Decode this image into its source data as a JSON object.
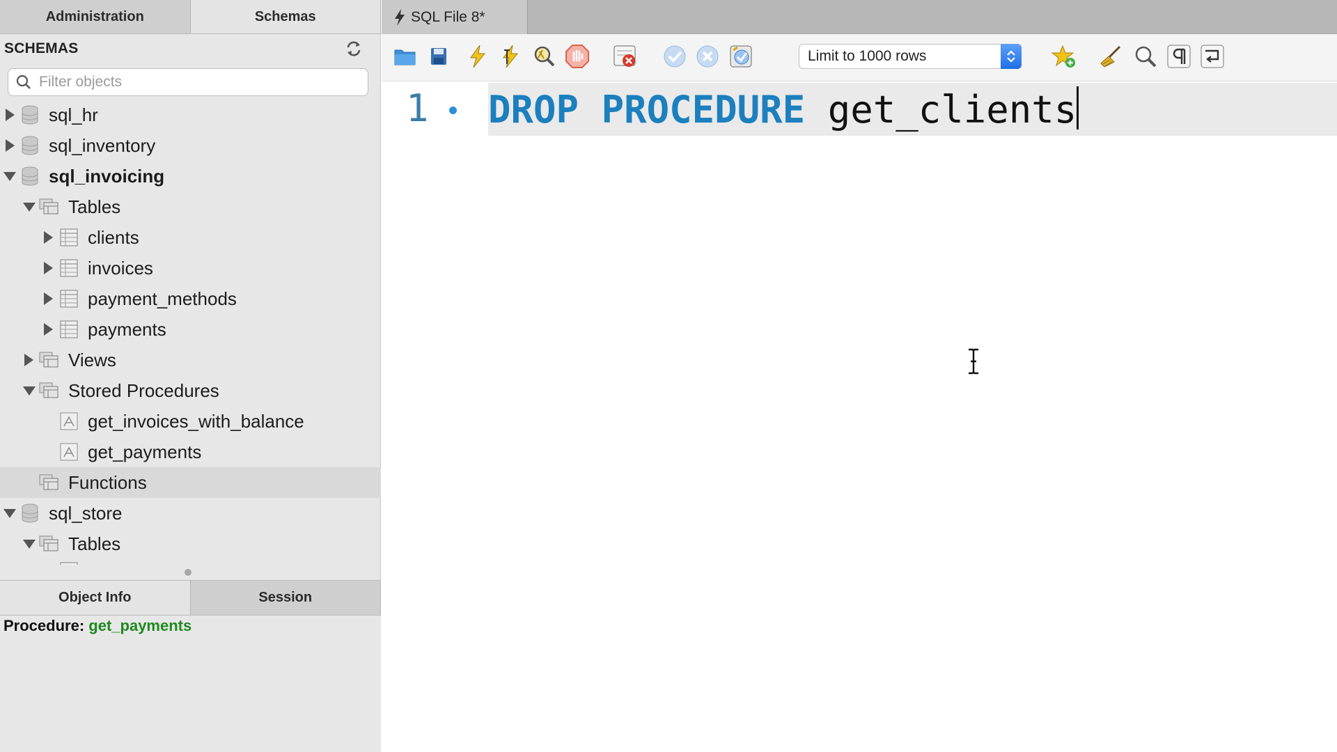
{
  "left_tabs": {
    "administration": "Administration",
    "schemas": "Schemas"
  },
  "schemas_header": "SCHEMAS",
  "filter": {
    "placeholder": "Filter objects",
    "value": ""
  },
  "tree": {
    "sql_hr": "sql_hr",
    "sql_inventory": "sql_inventory",
    "sql_invoicing": "sql_invoicing",
    "tables": "Tables",
    "clients": "clients",
    "invoices": "invoices",
    "payment_methods": "payment_methods",
    "payments": "payments",
    "views": "Views",
    "stored_procedures": "Stored Procedures",
    "proc1": "get_invoices_with_balance",
    "proc2": "get_payments",
    "functions": "Functions",
    "sql_store": "sql_store",
    "store_tables": "Tables"
  },
  "bottom_tabs": {
    "object_info": "Object Info",
    "session": "Session"
  },
  "info": {
    "label": "Procedure:",
    "value": "get_payments"
  },
  "file_tab": "SQL File 8*",
  "limit_select": "Limit to 1000 rows",
  "editor": {
    "line_number": "1",
    "keyword1": "DROP",
    "keyword2": "PROCEDURE",
    "identifier": "get_clients"
  },
  "colors": {
    "keyword": "#1c7fbe",
    "info_value": "#1f8a1f",
    "line_number": "#3c7ea6"
  },
  "icons": [
    "refresh-icon",
    "search-icon",
    "database-icon",
    "folder-icon",
    "table-icon",
    "procedure-icon",
    "open-file-icon",
    "save-icon",
    "execute-icon",
    "execute-current-icon",
    "explain-icon",
    "stop-icon",
    "toggle-error-icon",
    "commit-icon",
    "rollback-icon",
    "autocommit-icon",
    "bookmark-icon",
    "beautify-icon",
    "find-icon",
    "invisible-chars-icon",
    "word-wrap-icon",
    "ibeam-cursor-icon"
  ]
}
